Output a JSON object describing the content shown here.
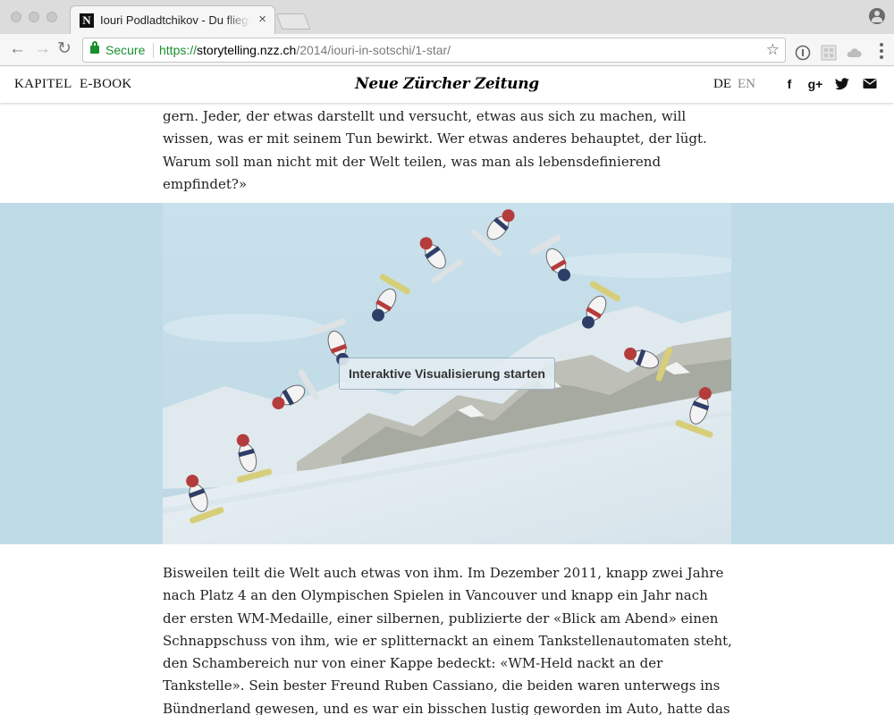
{
  "browser": {
    "tab_title": "Iouri Podladtchikov - Du fliegst",
    "tab_favicon": "N",
    "tab_close": "×",
    "nav_back": "←",
    "nav_forward": "→",
    "nav_reload": "↻",
    "secure_label": "Secure",
    "url_scheme": "https://",
    "url_host": "storytelling.nzz.ch",
    "url_path": "/2014/iouri-in-sotschi/1-star/",
    "star": "☆"
  },
  "header": {
    "nav": [
      "KAPITEL",
      "E-BOOK"
    ],
    "logo": "Neue Zürcher Zeitung",
    "lang_de": "DE",
    "lang_en": "EN",
    "social": [
      "f",
      "g+",
      "t",
      "✉"
    ]
  },
  "article": {
    "para1": "gern. Jeder, der etwas darstellt und versucht, etwas aus sich zu machen, will wissen, was er mit seinem Tun bewirkt. Wer etwas anderes behauptet, der lügt. Warum soll man nicht mit der Welt teilen, was man als lebensdefinierend empfindet?»",
    "viz_button": "Interaktive Visualisierung starten",
    "para2": "Bisweilen teilt die Welt auch etwas von ihm. Im Dezember 2011, knapp zwei Jahre nach Platz 4 an den Olympischen Spielen in Vancouver und knapp ein Jahr nach der ersten WM-Medaille, einer silbernen, publizierte der «Blick am Abend» einen Schnappschuss von ihm, wie er splitternackt an einem Tankstellenautomaten steht, den Schambereich nur von einer Kappe bedeckt: «WM-Held nackt an der Tankstelle». Sein bester Freund Ruben Cassiano, die beiden waren unterwegs ins Bündnerland gewesen, und es war ein bisschen lustig geworden im Auto, hatte das Bild auf Instagram gepostet. Cassiano hatte"
  },
  "colors": {
    "secure_green": "#1a8f2f",
    "viz_background": "#bfdbe8",
    "text": "#222222",
    "lang_inactive": "#888888"
  }
}
